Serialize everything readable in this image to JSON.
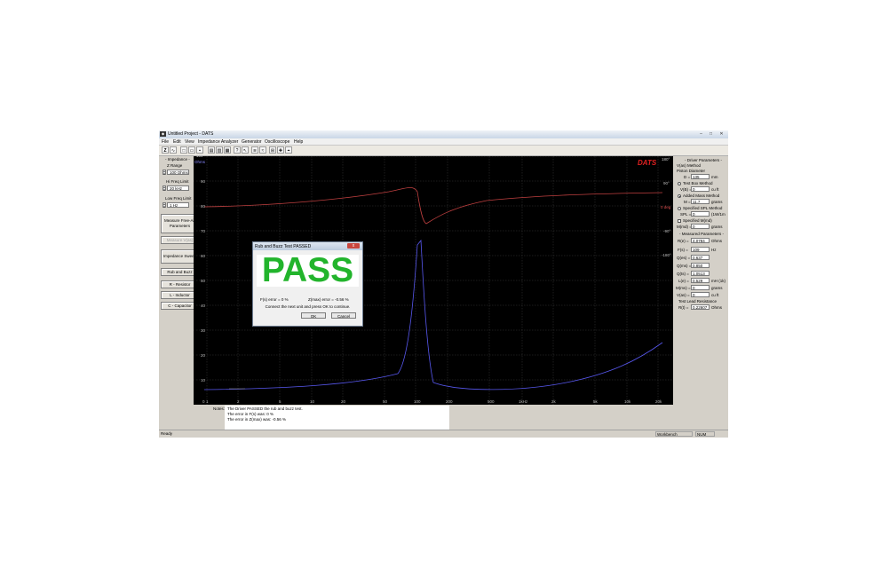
{
  "window": {
    "title": "Untitled Project - DATS",
    "minimize": "–",
    "maximize": "□",
    "close": "✕",
    "close_red": "x"
  },
  "menu": [
    "File",
    "Edit",
    "View",
    "Impedance Analyzer",
    "Generator",
    "Oscilloscope",
    "Help"
  ],
  "toolbar_icons": [
    "impedance-icon",
    "sine-icon",
    "new-icon",
    "open-icon",
    "save-icon",
    "print-icon",
    "chart-icon",
    "plot-icon",
    "help-icon",
    "whatsthis-icon",
    "analyzer-icon",
    "generator-icon",
    "scope-icon",
    "marker-icon",
    "cursor-icon"
  ],
  "left_panel": {
    "impedance_label": "- Impedance -",
    "z_range_label": "Z Range",
    "z_range_value": "100 Ohms",
    "hi_freq_label": "Hi Freq Limit",
    "hi_freq_value": "20 kHz",
    "low_freq_label": "Low Freq Limit",
    "low_freq_value": "1 Hz",
    "buttons": [
      "Measure Free-Air Parameters",
      "Measure V(as)",
      "Impedance Sweep",
      "Rub and Buzz",
      "R - Resistor",
      "L - Inductor",
      "C - Capacitor"
    ]
  },
  "plot": {
    "brand": "DATS",
    "y_left_unit": "Ohms",
    "y_left_ticks": [
      "100",
      "90",
      "80",
      "70",
      "60",
      "50",
      "40",
      "30",
      "20",
      "10",
      "0"
    ],
    "y_right_ticks": [
      "180°",
      "90°",
      "0 deg",
      "-90°",
      "-180°"
    ],
    "x_ticks": [
      "1",
      "2",
      "5",
      "10",
      "20",
      "50",
      "100",
      "200",
      "500",
      "1kHz",
      "2k",
      "5k",
      "10k",
      "20k"
    ],
    "impedance_color": "#5555ee",
    "phase_color": "#c04040"
  },
  "dialog": {
    "title": "Rub and Buzz Test PASSED",
    "pass_text": "PASS",
    "fs_error": "F(s) error =    0  %",
    "zmax_error": "Z(max) error = -0.56  %",
    "instruction": "Connect the next unit and press OK to continue.",
    "ok": "OK",
    "cancel": "Cancel"
  },
  "right_panel": {
    "driver_params_label": "- Driver Parameters -",
    "vas_method_label": "V(as) Method",
    "piston_label": "Piston Diameter",
    "d_label": "D =",
    "d_value": "135",
    "d_unit": "mm",
    "test_box_label": "Test Box Method",
    "vb_label": "V(B) =",
    "vb_value": "0",
    "vb_unit": "cu ft",
    "added_mass_label": "Added Mass Method",
    "m_label": "M =",
    "m_value": "11.7",
    "m_unit": "grams",
    "spl_label": "Specified SPL Method",
    "spl_eq": "SPL =",
    "spl_value": "0",
    "spl_unit": "(1W/1m",
    "mmd_check_label": "Specified M(md)",
    "mmd_label": "M(md) =",
    "mmd_value": "0",
    "mmd_unit": "grams",
    "measured_label": "- Measured Parameters -",
    "measured": [
      {
        "label": "R(e) =",
        "value": "4.0784",
        "unit": "Ohms"
      },
      {
        "label": "F(s) =",
        "value": "109",
        "unit": "Hz"
      },
      {
        "label": "Q(es) =",
        "value": "0.637",
        "unit": ""
      },
      {
        "label": "Q(ms) =",
        "value": "0.850",
        "unit": ""
      },
      {
        "label": "Q(ts) =",
        "value": "1.0513",
        "unit": ""
      },
      {
        "label": "L(e) =",
        "value": "0.529",
        "unit": "mH (1k)"
      },
      {
        "label": "M(ms) =",
        "value": "0",
        "unit": "grams"
      },
      {
        "label": "V(as) =",
        "value": "0",
        "unit": "cu ft"
      }
    ],
    "lead_label": "Test Lead Resistance",
    "r_label": "R(t) =",
    "r_value": "0.22607",
    "r_unit": "Ohms"
  },
  "notes": {
    "label": "Notes:",
    "lines": [
      "The Driver PASSED the rub and buzz test.",
      "The error in F(s) was:  0 %",
      "The error in Z(max) was: -0.56 %"
    ]
  },
  "status": {
    "ready": "Ready",
    "workbench": "Workbench",
    "num": "NUM"
  }
}
